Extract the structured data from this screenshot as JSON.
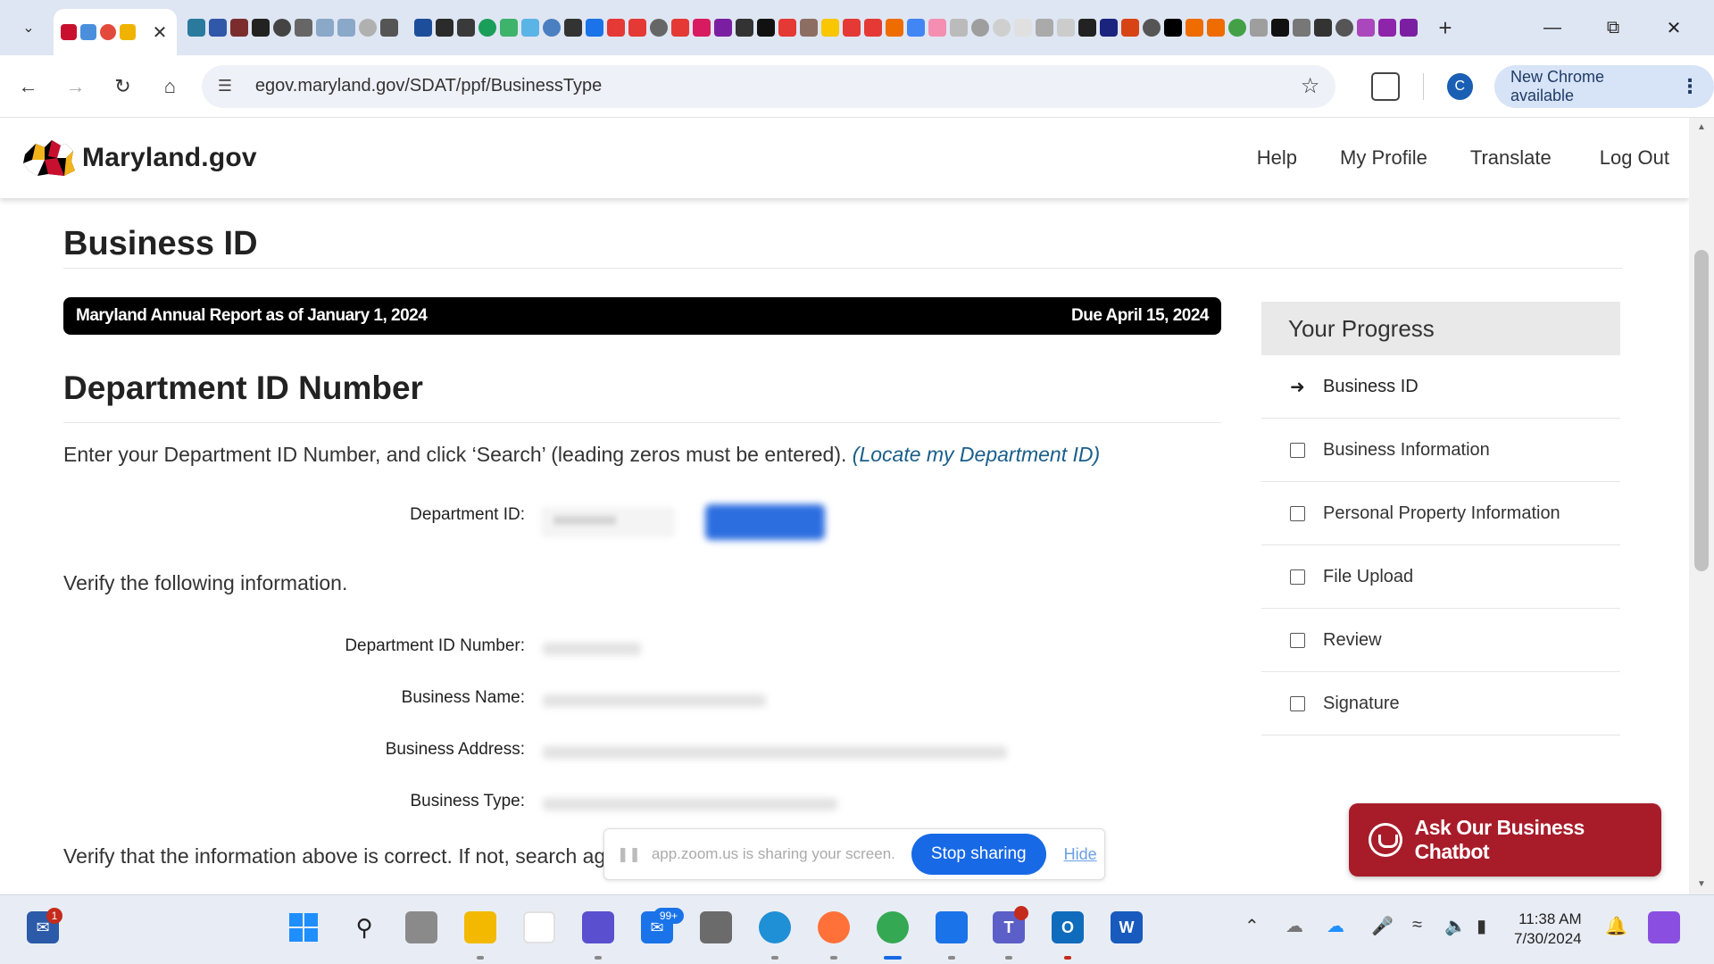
{
  "browser": {
    "active_tab_title": "",
    "omnibox_url": "egov.maryland.gov/SDAT/ppf/BusinessType",
    "new_chrome_label": "New Chrome available",
    "profile_initial": "C"
  },
  "site": {
    "logo_text": "Maryland.gov",
    "nav": {
      "help": "Help",
      "profile": "My Profile",
      "translate": "Translate",
      "logout": "Log Out"
    }
  },
  "page": {
    "title": "Business ID",
    "banner": {
      "left": "Maryland Annual Report as of January 1, 2024",
      "right": "Due April 15, 2024"
    },
    "section_title": "Department ID Number",
    "instructions": "Enter your Department ID Number, and click ‘Search’ (leading zeros must be entered).",
    "locate_link": "(Locate my Department ID)",
    "department_id_label": "Department ID:",
    "verify_text": "Verify the following information.",
    "fields": {
      "dept_id_number": "Department ID Number:",
      "business_name": "Business Name:",
      "business_address": "Business Address:",
      "business_type": "Business Type:"
    },
    "footer_text": "Verify that the information above is correct. If not, search ag"
  },
  "progress": {
    "heading": "Your Progress",
    "items": [
      {
        "label": "Business ID",
        "state": "current"
      },
      {
        "label": "Business Information",
        "state": "pending"
      },
      {
        "label": "Personal Property Information",
        "state": "pending"
      },
      {
        "label": "File Upload",
        "state": "pending"
      },
      {
        "label": "Review",
        "state": "pending"
      },
      {
        "label": "Signature",
        "state": "pending"
      }
    ]
  },
  "chatbot": {
    "label": "Ask Our Business Chatbot"
  },
  "zoom": {
    "sharing_text": "app.zoom.us is sharing your screen.",
    "stop_label": "Stop sharing",
    "hide_label": "Hide"
  },
  "taskbar": {
    "mail_badge": "1",
    "outlook_badge": "99+",
    "time": "11:38 AM",
    "date": "7/30/2024"
  },
  "colors": {
    "banner_bg": "#000000",
    "chatbot_bg": "#a81c2a",
    "link": "#1a5e8a",
    "zoom_stop": "#1769e6"
  }
}
